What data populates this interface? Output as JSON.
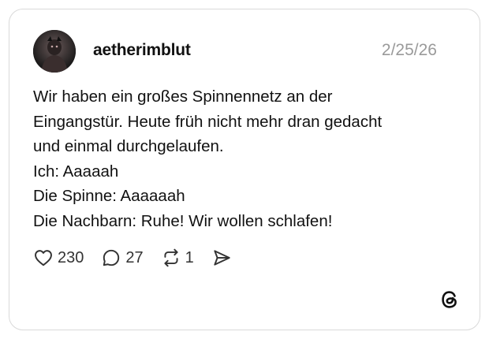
{
  "post": {
    "username": "aetherimblut",
    "date": "2/25/26",
    "lines": [
      "Wir haben ein großes Spinnennetz an der",
      "Eingangstür. Heute früh nicht mehr dran gedacht",
      "und einmal durchgelaufen.",
      "Ich: Aaaaah",
      "Die Spinne: Aaaaaah",
      "Die Nachbarn: Ruhe! Wir wollen schlafen!"
    ],
    "likes": "230",
    "replies": "27",
    "reposts": "1"
  },
  "icons": {
    "like": "heart-icon",
    "reply": "speech-bubble-icon",
    "repost": "repost-icon",
    "share": "send-icon",
    "brand": "threads-logo"
  },
  "colors": {
    "text": "#111111",
    "muted": "#9a9a9a",
    "border": "#d9d9d9"
  }
}
